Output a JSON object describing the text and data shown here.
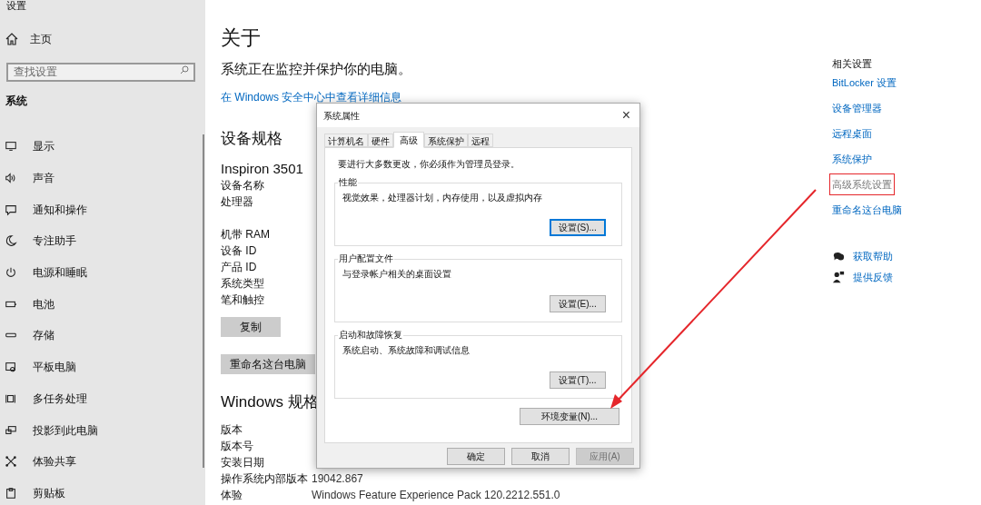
{
  "window": {
    "title": "设置"
  },
  "sidebar": {
    "home": "主页",
    "search": {
      "placeholder": "查找设置"
    },
    "section": "系统",
    "items": [
      {
        "label": "显示",
        "kind": "display"
      },
      {
        "label": "声音",
        "kind": "sound"
      },
      {
        "label": "通知和操作",
        "kind": "notification"
      },
      {
        "label": "专注助手",
        "kind": "moon"
      },
      {
        "label": "电源和睡眠",
        "kind": "power"
      },
      {
        "label": "电池",
        "kind": "battery"
      },
      {
        "label": "存储",
        "kind": "storage"
      },
      {
        "label": "平板电脑",
        "kind": "tablet"
      },
      {
        "label": "多任务处理",
        "kind": "multitask"
      },
      {
        "label": "投影到此电脑",
        "kind": "project"
      },
      {
        "label": "体验共享",
        "kind": "share"
      },
      {
        "label": "剪贴板",
        "kind": "clipboard"
      }
    ]
  },
  "content": {
    "title": "关于",
    "status": "系统正在监控并保护你的电脑。",
    "security_link": "在 Windows 安全中心中查看详细信息",
    "device_specs": {
      "heading": "设备规格",
      "model": "Inspiron 3501",
      "rows": [
        {
          "label": "设备名称"
        },
        {
          "label": "处理器"
        },
        {
          "label": "机带 RAM"
        },
        {
          "label": "设备 ID"
        },
        {
          "label": "产品 ID"
        },
        {
          "label": "系统类型"
        },
        {
          "label": "笔和触控"
        }
      ],
      "buttons": [
        "复制",
        "重命名这台电脑"
      ]
    },
    "windows_specs": {
      "heading": "Windows 规格",
      "rows": [
        {
          "label": "版本"
        },
        {
          "label": "版本号"
        },
        {
          "label": "安装日期"
        },
        {
          "label": "操作系统内部版本",
          "lines": [
            "19042.867"
          ]
        },
        {
          "label": "体验",
          "lines": [
            "Windows Feature Experience Pack 120.2212.551.0"
          ]
        }
      ]
    }
  },
  "related": {
    "heading": "相关设置",
    "links": [
      {
        "label": "BitLocker 设置",
        "highlighted": false
      },
      {
        "label": "设备管理器",
        "highlighted": false
      },
      {
        "label": "远程桌面",
        "highlighted": false
      },
      {
        "label": "系统保护",
        "highlighted": false
      },
      {
        "label": "高级系统设置",
        "highlighted": true
      },
      {
        "label": "重命名这台电脑",
        "highlighted": false
      }
    ],
    "help": [
      {
        "label": "获取帮助",
        "kind": "help"
      },
      {
        "label": "提供反馈",
        "kind": "feedback"
      }
    ]
  },
  "dialog": {
    "title": "系统属性",
    "close": "×",
    "tabs": [
      {
        "label": "计算机名",
        "selected": false
      },
      {
        "label": "硬件",
        "selected": false
      },
      {
        "label": "高级",
        "selected": true
      },
      {
        "label": "系统保护",
        "selected": false
      },
      {
        "label": "远程",
        "selected": false
      }
    ],
    "note": "要进行大多数更改，你必须作为管理员登录。",
    "groups": [
      {
        "title": "性能",
        "description": "视觉效果，处理器计划，内存使用，以及虚拟内存",
        "button": "设置(S)...",
        "focused": true
      },
      {
        "title": "用户配置文件",
        "description": "与登录帐户相关的桌面设置",
        "button": "设置(E)...",
        "focused": false
      },
      {
        "title": "启动和故障恢复",
        "description": "系统启动、系统故障和调试信息",
        "button": "设置(T)...",
        "focused": false
      }
    ],
    "env_button": "环境变量(N)...",
    "footer": [
      {
        "label": "确定",
        "disabled": false
      },
      {
        "label": "取消",
        "disabled": false
      },
      {
        "label": "应用(A)",
        "disabled": true
      }
    ]
  }
}
